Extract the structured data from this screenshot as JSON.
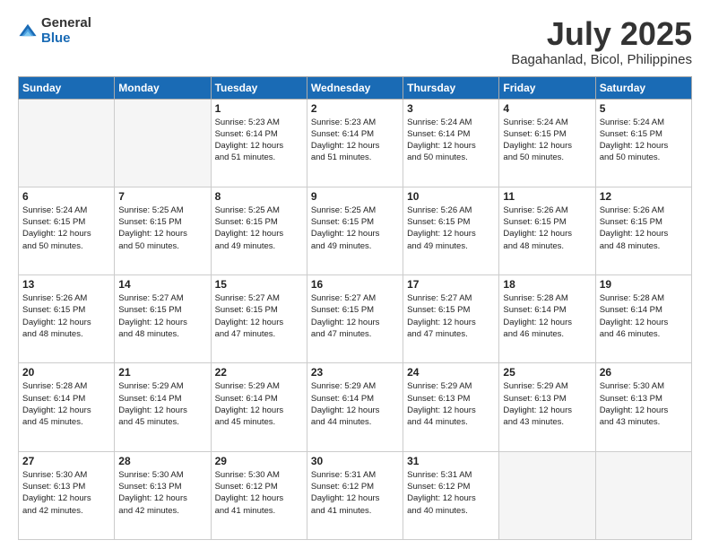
{
  "logo": {
    "general": "General",
    "blue": "Blue"
  },
  "title": "July 2025",
  "subtitle": "Bagahanlad, Bicol, Philippines",
  "days_of_week": [
    "Sunday",
    "Monday",
    "Tuesday",
    "Wednesday",
    "Thursday",
    "Friday",
    "Saturday"
  ],
  "weeks": [
    [
      {
        "day": "",
        "empty": true
      },
      {
        "day": "",
        "empty": true
      },
      {
        "day": "1",
        "sunrise": "5:23 AM",
        "sunset": "6:14 PM",
        "daylight": "12 hours and 51 minutes."
      },
      {
        "day": "2",
        "sunrise": "5:23 AM",
        "sunset": "6:14 PM",
        "daylight": "12 hours and 51 minutes."
      },
      {
        "day": "3",
        "sunrise": "5:24 AM",
        "sunset": "6:14 PM",
        "daylight": "12 hours and 50 minutes."
      },
      {
        "day": "4",
        "sunrise": "5:24 AM",
        "sunset": "6:15 PM",
        "daylight": "12 hours and 50 minutes."
      },
      {
        "day": "5",
        "sunrise": "5:24 AM",
        "sunset": "6:15 PM",
        "daylight": "12 hours and 50 minutes."
      }
    ],
    [
      {
        "day": "6",
        "sunrise": "5:24 AM",
        "sunset": "6:15 PM",
        "daylight": "12 hours and 50 minutes."
      },
      {
        "day": "7",
        "sunrise": "5:25 AM",
        "sunset": "6:15 PM",
        "daylight": "12 hours and 50 minutes."
      },
      {
        "day": "8",
        "sunrise": "5:25 AM",
        "sunset": "6:15 PM",
        "daylight": "12 hours and 49 minutes."
      },
      {
        "day": "9",
        "sunrise": "5:25 AM",
        "sunset": "6:15 PM",
        "daylight": "12 hours and 49 minutes."
      },
      {
        "day": "10",
        "sunrise": "5:26 AM",
        "sunset": "6:15 PM",
        "daylight": "12 hours and 49 minutes."
      },
      {
        "day": "11",
        "sunrise": "5:26 AM",
        "sunset": "6:15 PM",
        "daylight": "12 hours and 48 minutes."
      },
      {
        "day": "12",
        "sunrise": "5:26 AM",
        "sunset": "6:15 PM",
        "daylight": "12 hours and 48 minutes."
      }
    ],
    [
      {
        "day": "13",
        "sunrise": "5:26 AM",
        "sunset": "6:15 PM",
        "daylight": "12 hours and 48 minutes."
      },
      {
        "day": "14",
        "sunrise": "5:27 AM",
        "sunset": "6:15 PM",
        "daylight": "12 hours and 48 minutes."
      },
      {
        "day": "15",
        "sunrise": "5:27 AM",
        "sunset": "6:15 PM",
        "daylight": "12 hours and 47 minutes."
      },
      {
        "day": "16",
        "sunrise": "5:27 AM",
        "sunset": "6:15 PM",
        "daylight": "12 hours and 47 minutes."
      },
      {
        "day": "17",
        "sunrise": "5:27 AM",
        "sunset": "6:15 PM",
        "daylight": "12 hours and 47 minutes."
      },
      {
        "day": "18",
        "sunrise": "5:28 AM",
        "sunset": "6:14 PM",
        "daylight": "12 hours and 46 minutes."
      },
      {
        "day": "19",
        "sunrise": "5:28 AM",
        "sunset": "6:14 PM",
        "daylight": "12 hours and 46 minutes."
      }
    ],
    [
      {
        "day": "20",
        "sunrise": "5:28 AM",
        "sunset": "6:14 PM",
        "daylight": "12 hours and 45 minutes."
      },
      {
        "day": "21",
        "sunrise": "5:29 AM",
        "sunset": "6:14 PM",
        "daylight": "12 hours and 45 minutes."
      },
      {
        "day": "22",
        "sunrise": "5:29 AM",
        "sunset": "6:14 PM",
        "daylight": "12 hours and 45 minutes."
      },
      {
        "day": "23",
        "sunrise": "5:29 AM",
        "sunset": "6:14 PM",
        "daylight": "12 hours and 44 minutes."
      },
      {
        "day": "24",
        "sunrise": "5:29 AM",
        "sunset": "6:13 PM",
        "daylight": "12 hours and 44 minutes."
      },
      {
        "day": "25",
        "sunrise": "5:29 AM",
        "sunset": "6:13 PM",
        "daylight": "12 hours and 43 minutes."
      },
      {
        "day": "26",
        "sunrise": "5:30 AM",
        "sunset": "6:13 PM",
        "daylight": "12 hours and 43 minutes."
      }
    ],
    [
      {
        "day": "27",
        "sunrise": "5:30 AM",
        "sunset": "6:13 PM",
        "daylight": "12 hours and 42 minutes."
      },
      {
        "day": "28",
        "sunrise": "5:30 AM",
        "sunset": "6:13 PM",
        "daylight": "12 hours and 42 minutes."
      },
      {
        "day": "29",
        "sunrise": "5:30 AM",
        "sunset": "6:12 PM",
        "daylight": "12 hours and 41 minutes."
      },
      {
        "day": "30",
        "sunrise": "5:31 AM",
        "sunset": "6:12 PM",
        "daylight": "12 hours and 41 minutes."
      },
      {
        "day": "31",
        "sunrise": "5:31 AM",
        "sunset": "6:12 PM",
        "daylight": "12 hours and 40 minutes."
      },
      {
        "day": "",
        "empty": true
      },
      {
        "day": "",
        "empty": true
      }
    ]
  ],
  "labels": {
    "sunrise": "Sunrise:",
    "sunset": "Sunset:",
    "daylight": "Daylight:"
  }
}
